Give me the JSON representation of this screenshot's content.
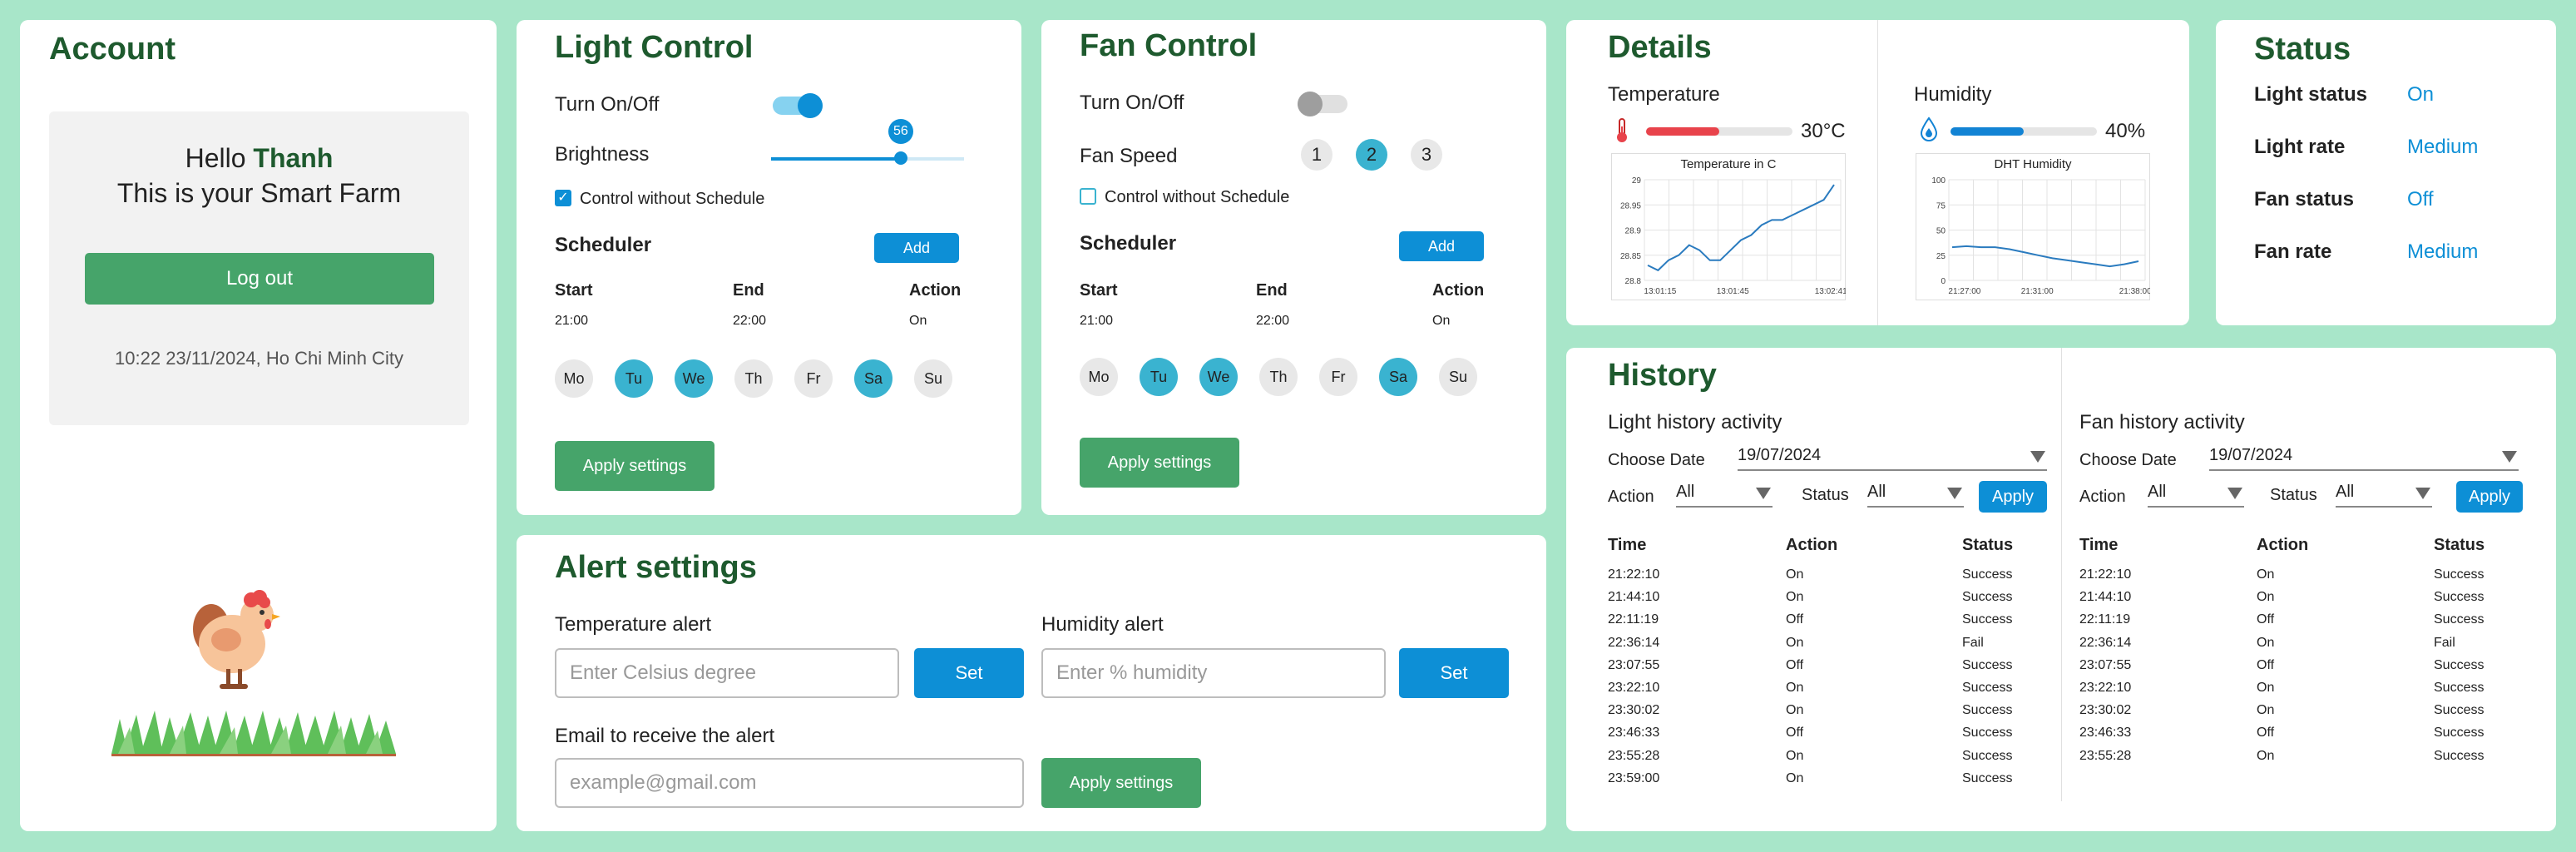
{
  "account": {
    "title": "Account",
    "hello": "Hello",
    "name": "Thanh",
    "subtitle": "This is your Smart Farm",
    "logout": "Log out",
    "datetime": "10:22 23/11/2024, Ho Chi Minh City"
  },
  "light_control": {
    "title": "Light Control",
    "toggle_label": "Turn On/Off",
    "toggle_on": true,
    "brightness_label": "Brightness",
    "brightness_value": "56",
    "brightness_fraction": 0.56,
    "checkbox_label": "Control without Schedule",
    "checkbox_checked": true,
    "scheduler_label": "Scheduler",
    "add_label": "Add",
    "col_start": "Start",
    "col_end": "End",
    "col_action": "Action",
    "start": "21:00",
    "end": "22:00",
    "action": "On",
    "days": [
      {
        "label": "Mo",
        "on": false
      },
      {
        "label": "Tu",
        "on": true
      },
      {
        "label": "We",
        "on": true
      },
      {
        "label": "Th",
        "on": false
      },
      {
        "label": "Fr",
        "on": false
      },
      {
        "label": "Sa",
        "on": true
      },
      {
        "label": "Su",
        "on": false
      }
    ],
    "apply": "Apply settings"
  },
  "fan_control": {
    "title": "Fan Control",
    "toggle_label": "Turn On/Off",
    "toggle_on": false,
    "speed_label": "Fan Speed",
    "speeds": [
      "1",
      "2",
      "3"
    ],
    "selected_speed": "2",
    "checkbox_label": "Control without Schedule",
    "checkbox_checked": false,
    "scheduler_label": "Scheduler",
    "add_label": "Add",
    "col_start": "Start",
    "col_end": "End",
    "col_action": "Action",
    "start": "21:00",
    "end": "22:00",
    "action": "On",
    "days": [
      {
        "label": "Mo",
        "on": false
      },
      {
        "label": "Tu",
        "on": true
      },
      {
        "label": "We",
        "on": true
      },
      {
        "label": "Th",
        "on": false
      },
      {
        "label": "Fr",
        "on": false
      },
      {
        "label": "Sa",
        "on": true
      },
      {
        "label": "Su",
        "on": false
      }
    ],
    "apply": "Apply settings"
  },
  "alert": {
    "title": "Alert settings",
    "temp_label": "Temperature alert",
    "temp_placeholder": "Enter Celsius degree",
    "hum_label": "Humidity alert",
    "hum_placeholder": "Enter % humidity",
    "set_label": "Set",
    "email_label": "Email to receive the alert",
    "email_placeholder": "example@gmail.com",
    "apply": "Apply settings"
  },
  "details": {
    "title": "Details",
    "temp_label": "Temperature",
    "temp_value": "30°C",
    "temp_fraction": 0.5,
    "hum_label": "Humidity",
    "hum_value": "40%",
    "hum_fraction": 0.5,
    "colors": {
      "temp": "#e8434b",
      "hum": "#1283d4"
    }
  },
  "status": {
    "title": "Status",
    "items": [
      {
        "label": "Light status",
        "value": "On"
      },
      {
        "label": "Light rate",
        "value": "Medium"
      },
      {
        "label": "Fan status",
        "value": "Off"
      },
      {
        "label": "Fan rate",
        "value": "Medium"
      }
    ]
  },
  "history": {
    "title": "History",
    "light": {
      "title": "Light history activity",
      "date_label": "Choose Date",
      "date_value": "19/07/2024",
      "action_label": "Action",
      "action_value": "All",
      "status_label": "Status",
      "status_value": "All",
      "apply": "Apply",
      "headers": [
        "Time",
        "Action",
        "Status"
      ],
      "rows": [
        [
          "21:22:10",
          "On",
          "Success"
        ],
        [
          "21:44:10",
          "On",
          "Success"
        ],
        [
          "22:11:19",
          "Off",
          "Success"
        ],
        [
          "22:36:14",
          "On",
          "Fail"
        ],
        [
          "23:07:55",
          "Off",
          "Success"
        ],
        [
          "23:22:10",
          "On",
          "Success"
        ],
        [
          "23:30:02",
          "On",
          "Success"
        ],
        [
          "23:46:33",
          "Off",
          "Success"
        ],
        [
          "23:55:28",
          "On",
          "Success"
        ],
        [
          "23:59:00",
          "On",
          "Success"
        ]
      ]
    },
    "fan": {
      "title": "Fan history activity",
      "date_label": "Choose Date",
      "date_value": "19/07/2024",
      "action_label": "Action",
      "action_value": "All",
      "status_label": "Status",
      "status_value": "All",
      "apply": "Apply",
      "headers": [
        "Time",
        "Action",
        "Status"
      ],
      "rows": [
        [
          "21:22:10",
          "On",
          "Success"
        ],
        [
          "21:44:10",
          "On",
          "Success"
        ],
        [
          "22:11:19",
          "Off",
          "Success"
        ],
        [
          "22:36:14",
          "On",
          "Fail"
        ],
        [
          "23:07:55",
          "Off",
          "Success"
        ],
        [
          "23:22:10",
          "On",
          "Success"
        ],
        [
          "23:30:02",
          "On",
          "Success"
        ],
        [
          "23:46:33",
          "Off",
          "Success"
        ],
        [
          "23:55:28",
          "On",
          "Success"
        ]
      ]
    }
  },
  "chart_data": [
    {
      "type": "line",
      "title": "Temperature in C",
      "x_ticks": [
        "13:01:15",
        "13:01:45",
        "13:02:41"
      ],
      "y_ticks": [
        "28.8",
        "28.85",
        "28.9",
        "28.95",
        "29"
      ],
      "ylim": [
        28.8,
        29.0
      ],
      "grid": true,
      "values": [
        28.83,
        28.82,
        28.84,
        28.85,
        28.87,
        28.86,
        28.84,
        28.84,
        28.86,
        28.88,
        28.89,
        28.91,
        28.92,
        28.92,
        28.93,
        28.94,
        28.95,
        28.96,
        28.99
      ],
      "color": "#2a7bbf"
    },
    {
      "type": "line",
      "title": "DHT Humidity",
      "x_ticks": [
        "21:27:00",
        "21:31:00",
        "21:38:00"
      ],
      "y_ticks": [
        "0",
        "25",
        "50",
        "75",
        "100"
      ],
      "ylim": [
        0,
        100
      ],
      "grid": true,
      "values": [
        33,
        34,
        33,
        33,
        31,
        28,
        25,
        22,
        20,
        18,
        16,
        14,
        16,
        19
      ],
      "color": "#2a7bbf"
    }
  ]
}
